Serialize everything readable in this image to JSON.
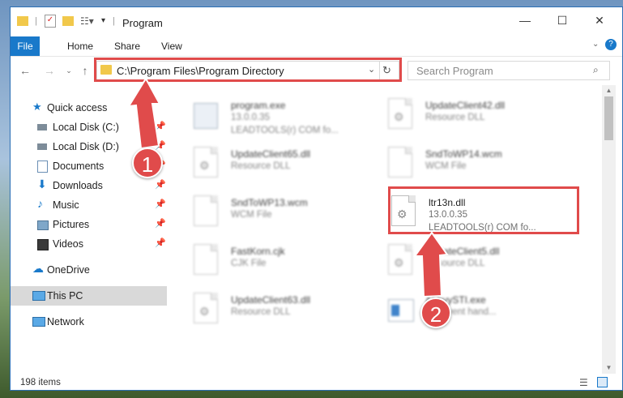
{
  "window": {
    "title": "Program"
  },
  "ribbon": {
    "tabs": [
      "File",
      "Home",
      "Share",
      "View"
    ]
  },
  "address": {
    "path": "C:\\Program Files\\Program Directory"
  },
  "search": {
    "placeholder": "Search Program"
  },
  "nav": {
    "items": [
      {
        "label": "Quick access",
        "icon": "star-icon",
        "pinned": false
      },
      {
        "label": "Local Disk (C:)",
        "icon": "drive-icon",
        "pinned": true
      },
      {
        "label": "Local Disk (D:)",
        "icon": "drive-icon",
        "pinned": true
      },
      {
        "label": "Documents",
        "icon": "documents-icon",
        "pinned": true
      },
      {
        "label": "Downloads",
        "icon": "download-icon",
        "pinned": true
      },
      {
        "label": "Music",
        "icon": "music-icon",
        "pinned": true
      },
      {
        "label": "Pictures",
        "icon": "pictures-icon",
        "pinned": true
      },
      {
        "label": "Videos",
        "icon": "videos-icon",
        "pinned": true
      },
      {
        "label": "OneDrive",
        "icon": "cloud-icon",
        "pinned": false
      },
      {
        "label": "This PC",
        "icon": "computer-icon",
        "pinned": false,
        "selected": true
      },
      {
        "label": "Network",
        "icon": "network-icon",
        "pinned": false
      }
    ]
  },
  "files": [
    {
      "name": "program.exe",
      "line2": "13.0.0.35",
      "line3": "LEADTOOLS(r) COM fo..."
    },
    {
      "name": "UpdateClient42.dll",
      "line2": "Resource DLL",
      "line3": ""
    },
    {
      "name": "UpdateClient65.dll",
      "line2": "Resource DLL",
      "line3": ""
    },
    {
      "name": "SndToWP14.wcm",
      "line2": "WCM File",
      "line3": ""
    },
    {
      "name": "SndToWP13.wcm",
      "line2": "WCM File",
      "line3": ""
    },
    {
      "name": "ltr13n.dll",
      "line2": "13.0.0.35",
      "line3": "LEADTOOLS(r) COM fo..."
    },
    {
      "name": "FastKorn.cjk",
      "line2": "CJK File",
      "line3": ""
    },
    {
      "name": "UpdateClient5.dll",
      "line2": "Resource DLL",
      "line3": ""
    },
    {
      "name": "UpdateClient63.dll",
      "line2": "Resource DLL",
      "line3": ""
    },
    {
      "name": "AbbyySTI.exe",
      "line2": "STI event hand...",
      "line3": ""
    }
  ],
  "status": {
    "items_count": "198 items"
  },
  "annotations": {
    "step1": "1",
    "step2": "2",
    "color": "#e04b4b"
  }
}
